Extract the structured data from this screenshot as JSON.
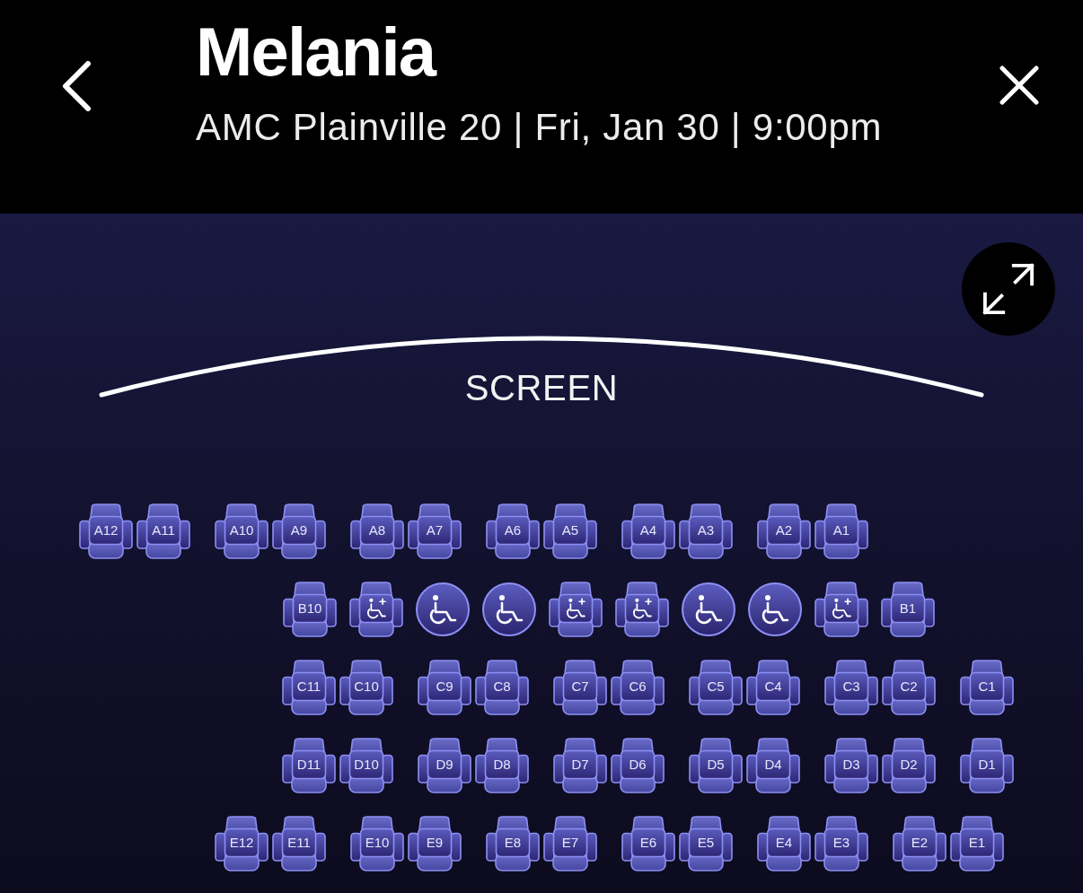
{
  "header": {
    "title": "Melania",
    "subtitle": "AMC Plainville 20 | Fri, Jan 30 | 9:00pm"
  },
  "screen": {
    "label": "SCREEN"
  },
  "rows": [
    {
      "groups": [
        {
          "seats": [
            {
              "kind": "seat",
              "label": "A12",
              "selected": false
            },
            {
              "kind": "seat",
              "label": "A11",
              "selected": false
            }
          ]
        },
        {
          "seats": [
            {
              "kind": "seat",
              "label": "A10",
              "selected": false
            },
            {
              "kind": "seat",
              "label": "A9",
              "selected": false
            }
          ]
        },
        {
          "seats": [
            {
              "kind": "seat",
              "label": "A8",
              "selected": false
            },
            {
              "kind": "seat",
              "label": "A7",
              "selected": false
            }
          ]
        },
        {
          "seats": [
            {
              "kind": "seat",
              "label": "A6",
              "selected": false
            },
            {
              "kind": "seat",
              "label": "A5",
              "selected": false
            }
          ]
        },
        {
          "seats": [
            {
              "kind": "seat",
              "label": "A4",
              "selected": false
            },
            {
              "kind": "seat",
              "label": "A3",
              "selected": false
            }
          ]
        },
        {
          "seats": [
            {
              "kind": "seat",
              "label": "A2",
              "selected": false
            },
            {
              "kind": "seat",
              "label": "A1",
              "selected": false
            }
          ]
        }
      ]
    },
    {
      "groups": [
        {
          "seats": [
            {
              "kind": "seat",
              "label": "B10",
              "selected": false
            },
            {
              "kind": "companion",
              "selected": false
            },
            {
              "kind": "wheelchair",
              "selected": false
            },
            {
              "kind": "wheelchair",
              "selected": false
            },
            {
              "kind": "companion",
              "selected": false
            },
            {
              "kind": "companion",
              "selected": false
            },
            {
              "kind": "wheelchair",
              "selected": false
            },
            {
              "kind": "wheelchair",
              "selected": false
            },
            {
              "kind": "companion",
              "selected": false
            },
            {
              "kind": "seat",
              "label": "B1",
              "selected": false
            }
          ]
        }
      ]
    },
    {
      "groups": [
        {
          "seats": [
            {
              "kind": "seat",
              "label": "C11",
              "selected": false
            },
            {
              "kind": "seat",
              "label": "C10",
              "selected": false
            }
          ]
        },
        {
          "seats": [
            {
              "kind": "seat",
              "label": "C9",
              "selected": false
            },
            {
              "kind": "seat",
              "label": "C8",
              "selected": false
            }
          ]
        },
        {
          "seats": [
            {
              "kind": "seat",
              "label": "C7",
              "selected": false
            },
            {
              "kind": "seat",
              "label": "C6",
              "selected": false
            }
          ]
        },
        {
          "seats": [
            {
              "kind": "seat",
              "label": "C5",
              "selected": false
            },
            {
              "kind": "seat",
              "label": "C4",
              "selected": false
            }
          ]
        },
        {
          "seats": [
            {
              "kind": "seat",
              "label": "C3",
              "selected": false
            },
            {
              "kind": "seat",
              "label": "C2",
              "selected": false
            }
          ]
        },
        {
          "seats": [
            {
              "kind": "seat",
              "label": "C1",
              "selected": false
            }
          ]
        }
      ]
    },
    {
      "groups": [
        {
          "seats": [
            {
              "kind": "seat",
              "label": "D11",
              "selected": false
            },
            {
              "kind": "seat",
              "label": "D10",
              "selected": false
            }
          ]
        },
        {
          "seats": [
            {
              "kind": "seat",
              "label": "D9",
              "selected": false
            },
            {
              "kind": "seat",
              "label": "D8",
              "selected": false
            }
          ]
        },
        {
          "seats": [
            {
              "kind": "seat",
              "label": "D7",
              "selected": false
            },
            {
              "kind": "seat",
              "label": "D6",
              "selected": false
            }
          ]
        },
        {
          "seats": [
            {
              "kind": "seat",
              "label": "D5",
              "selected": false
            },
            {
              "kind": "seat",
              "label": "D4",
              "selected": false
            }
          ]
        },
        {
          "seats": [
            {
              "kind": "seat",
              "label": "D3",
              "selected": false
            },
            {
              "kind": "seat",
              "label": "D2",
              "selected": false
            }
          ]
        },
        {
          "seats": [
            {
              "kind": "seat",
              "label": "D1",
              "selected": false
            }
          ]
        }
      ]
    },
    {
      "groups": [
        {
          "seats": [
            {
              "kind": "seat",
              "label": "E12",
              "selected": false
            },
            {
              "kind": "seat",
              "label": "E11",
              "selected": false
            }
          ]
        },
        {
          "seats": [
            {
              "kind": "seat",
              "label": "E10",
              "selected": false
            },
            {
              "kind": "seat",
              "label": "E9",
              "selected": false
            }
          ]
        },
        {
          "seats": [
            {
              "kind": "seat",
              "label": "E8",
              "selected": false
            },
            {
              "kind": "seat",
              "label": "E7",
              "selected": false
            }
          ]
        },
        {
          "seats": [
            {
              "kind": "seat",
              "label": "E6",
              "selected": false
            },
            {
              "kind": "seat",
              "label": "E5",
              "selected": false
            }
          ]
        },
        {
          "seats": [
            {
              "kind": "seat",
              "label": "E4",
              "selected": false
            },
            {
              "kind": "seat",
              "label": "E3",
              "selected": false
            }
          ]
        },
        {
          "seats": [
            {
              "kind": "seat",
              "label": "E2",
              "selected": false
            },
            {
              "kind": "seat",
              "label": "E1",
              "selected": false
            }
          ]
        }
      ]
    }
  ]
}
